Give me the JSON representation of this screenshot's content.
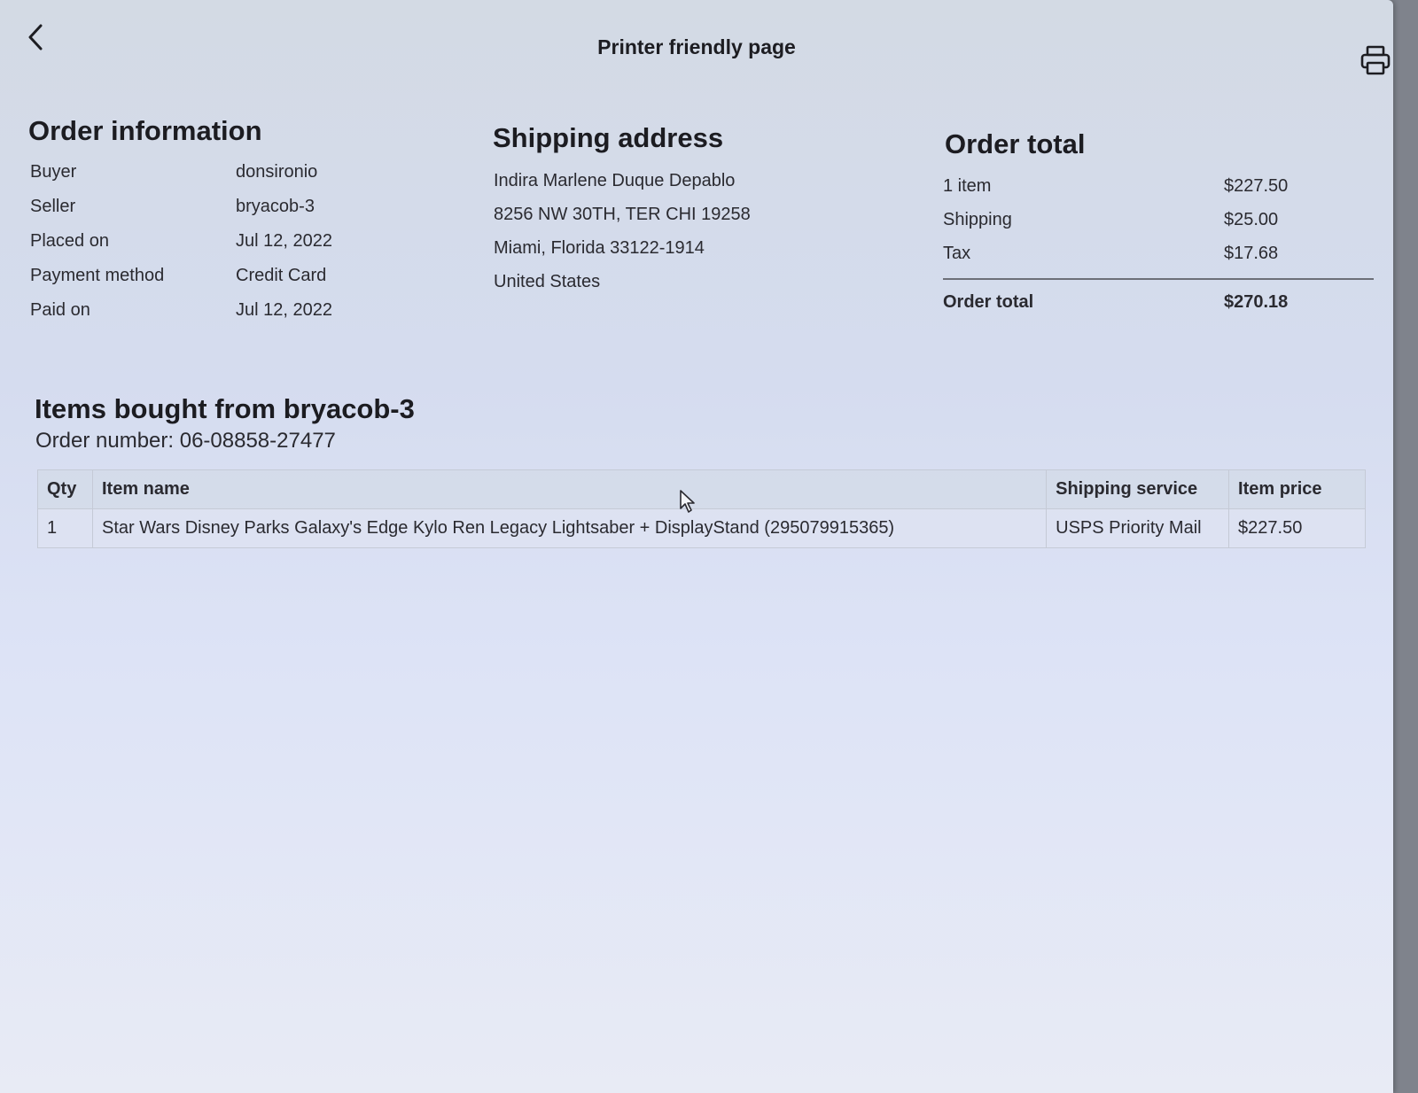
{
  "header": {
    "back": "back-arrow",
    "title": "Printer friendly page",
    "print_icon": "printer-icon"
  },
  "order_information": {
    "heading": "Order information",
    "rows": [
      {
        "label": "Buyer",
        "value": "donsironio"
      },
      {
        "label": "Seller",
        "value": "bryacob-3"
      },
      {
        "label": "Placed on",
        "value": "Jul 12, 2022"
      },
      {
        "label": "Payment method",
        "value": "Credit Card"
      },
      {
        "label": "Paid on",
        "value": "Jul 12, 2022"
      }
    ]
  },
  "shipping_address": {
    "heading": "Shipping address",
    "lines": [
      "Indira Marlene Duque Depablo",
      "8256 NW 30TH, TER CHI 19258",
      "Miami, Florida 33122-1914",
      "United States"
    ]
  },
  "order_total": {
    "heading": "Order total",
    "rows": [
      {
        "label": "1 item",
        "value": "$227.50"
      },
      {
        "label": "Shipping",
        "value": "$25.00"
      },
      {
        "label": "Tax",
        "value": "$17.68"
      }
    ],
    "total": {
      "label": "Order total",
      "value": "$270.18"
    }
  },
  "items": {
    "heading": "Items bought from bryacob-3",
    "order_number": "Order number: 06-08858-27477",
    "columns": [
      "Qty",
      "Item name",
      "Shipping service",
      "Item price"
    ],
    "rows": [
      {
        "qty": "1",
        "name": "Star Wars Disney Parks Galaxy's Edge Kylo Ren Legacy Lightsaber + DisplayStand (295079915365)",
        "shipping": "USPS Priority Mail",
        "price": "$227.50"
      }
    ]
  }
}
